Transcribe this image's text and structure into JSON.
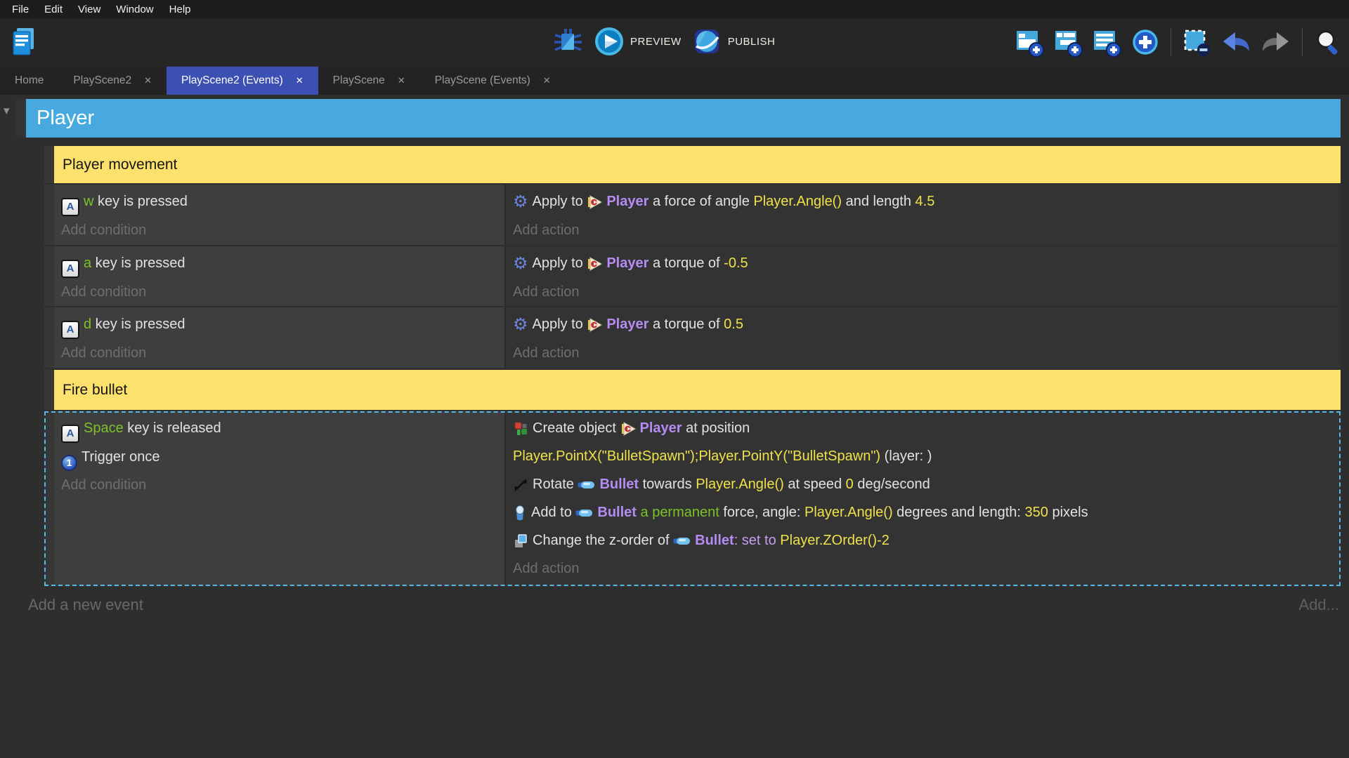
{
  "menu": {
    "items": [
      "File",
      "Edit",
      "View",
      "Window",
      "Help"
    ]
  },
  "toolbar": {
    "preview_label": "PREVIEW",
    "publish_label": "PUBLISH",
    "icon_names": [
      "project-manager",
      "debugger",
      "preview-play",
      "publish-globe",
      "add-event",
      "add-subevent",
      "add-comment",
      "choose-add-event",
      "remove-event",
      "undo",
      "redo",
      "search"
    ]
  },
  "tabs": [
    {
      "label": "Home",
      "closable": false,
      "active": false
    },
    {
      "label": "PlayScene2",
      "closable": true,
      "active": false
    },
    {
      "label": "PlayScene2 (Events)",
      "closable": true,
      "active": true
    },
    {
      "label": "PlayScene",
      "closable": true,
      "active": false
    },
    {
      "label": "PlayScene (Events)",
      "closable": true,
      "active": false
    }
  ],
  "icons": {
    "keyboard_letter": "A",
    "trigger_once_digit": "1",
    "gear_glyph": "⚙",
    "close_glyph": "✕",
    "group_collapse_glyph": "▾"
  },
  "colors": {
    "group_bar_blue": "#48a9de",
    "comment_yellow": "#fce26d",
    "active_tab_indigo": "#3c50b4",
    "object_purple": "#b48cf2",
    "expression_yellow": "#efe24a",
    "key_green": "#7cc226",
    "selection_dashed_blue": "#58b8e8"
  },
  "sheet": {
    "group_title": "Player",
    "comment_player_movement": "Player movement",
    "comment_fire_bullet": "Fire bullet",
    "placeholders": {
      "add_condition": "Add condition",
      "add_action": "Add action",
      "add_new_event": "Add a new event",
      "add_more": "Add..."
    },
    "event1": {
      "cond_key": "w",
      "cond_text": " key is pressed",
      "act_pre": "Apply to ",
      "act_object": "Player",
      "act_mid": " a force of angle ",
      "act_expr": "Player.Angle()",
      "act_mid2": " and length ",
      "act_value": "4.5"
    },
    "event2": {
      "cond_key": "a",
      "cond_text": " key is pressed",
      "act_pre": "Apply to ",
      "act_object": "Player",
      "act_mid": " a torque of ",
      "act_value": "-0.5"
    },
    "event3": {
      "cond_key": "d",
      "cond_text": " key is pressed",
      "act_pre": "Apply to ",
      "act_object": "Player",
      "act_mid": " a torque of ",
      "act_value": "0.5"
    },
    "event4": {
      "cond1_key": "Space",
      "cond1_text": " key is released",
      "cond2_text": "Trigger once",
      "act1_pre": "Create object ",
      "act1_object": "Player",
      "act1_post": " at position",
      "act1_expr": "Player.PointX(\"BulletSpawn\");Player.PointY(\"BulletSpawn\")",
      "act1_layer": " (layer: )",
      "act2_pre": "Rotate ",
      "act2_object": "Bullet",
      "act2_mid": " towards ",
      "act2_expr": "Player.Angle()",
      "act2_mid2": " at speed ",
      "act2_value": "0",
      "act2_post": " deg/second",
      "act3_pre": "Add to ",
      "act3_object": "Bullet",
      "act3_green": " a permanent ",
      "act3_mid": "force, angle: ",
      "act3_expr": "Player.Angle()",
      "act3_mid2": " degrees and length: ",
      "act3_value": "350",
      "act3_post": " pixels",
      "act4_pre": "Change the z-order of ",
      "act4_object": "Bullet",
      "act4_setto": ": set to ",
      "act4_expr": "Player.ZOrder()-2"
    }
  }
}
